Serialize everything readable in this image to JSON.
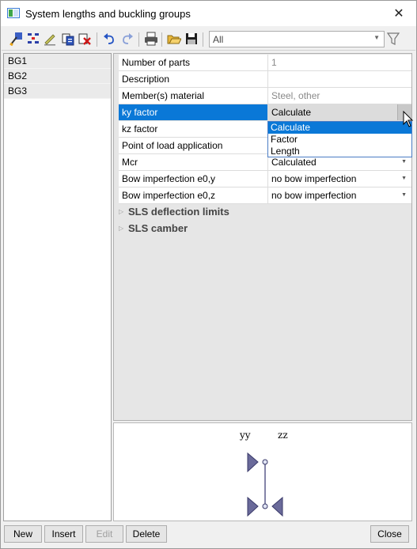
{
  "window": {
    "title": "System lengths and buckling groups",
    "close_glyph": "✕"
  },
  "toolbar": {
    "icons": [
      "select-icon",
      "align-icon",
      "edit-icon",
      "copy-icon",
      "delete-icon",
      "undo-icon",
      "redo-icon",
      "print-icon",
      "open-icon",
      "save-icon",
      "filter-icon"
    ],
    "filter_value": "All"
  },
  "groups": [
    "BG1",
    "BG2",
    "BG3"
  ],
  "properties": [
    {
      "label": "Number of parts",
      "value": "1",
      "disabled": true,
      "dropdown": false
    },
    {
      "label": "Description",
      "value": "",
      "disabled": false,
      "dropdown": false
    },
    {
      "label": "Member(s) material",
      "value": "Steel, other",
      "disabled": true,
      "dropdown": false
    },
    {
      "label": "ky factor",
      "value": "Calculate",
      "disabled": false,
      "dropdown": true,
      "selected": true
    },
    {
      "label": "kz factor",
      "value": "",
      "disabled": false,
      "dropdown": false
    },
    {
      "label": "Point of load application",
      "value": "",
      "disabled": false,
      "dropdown": false
    },
    {
      "label": "Mcr",
      "value": "Calculated",
      "disabled": false,
      "dropdown": true
    },
    {
      "label": "Bow imperfection e0,y",
      "value": "no bow imperfection",
      "disabled": false,
      "dropdown": true
    },
    {
      "label": "Bow imperfection e0,z",
      "value": "no bow imperfection",
      "disabled": false,
      "dropdown": true
    }
  ],
  "sections": [
    "SLS deflection limits",
    "SLS camber"
  ],
  "dropdown_options": [
    "Calculate",
    "Factor",
    "Length"
  ],
  "preview": {
    "label_y": "yy",
    "label_z": "zz"
  },
  "buttons": {
    "new": "New",
    "insert": "Insert",
    "edit": "Edit",
    "delete": "Delete",
    "close": "Close"
  },
  "colors": {
    "selection": "#0a78d7",
    "popup_border": "#4a7cc4"
  }
}
